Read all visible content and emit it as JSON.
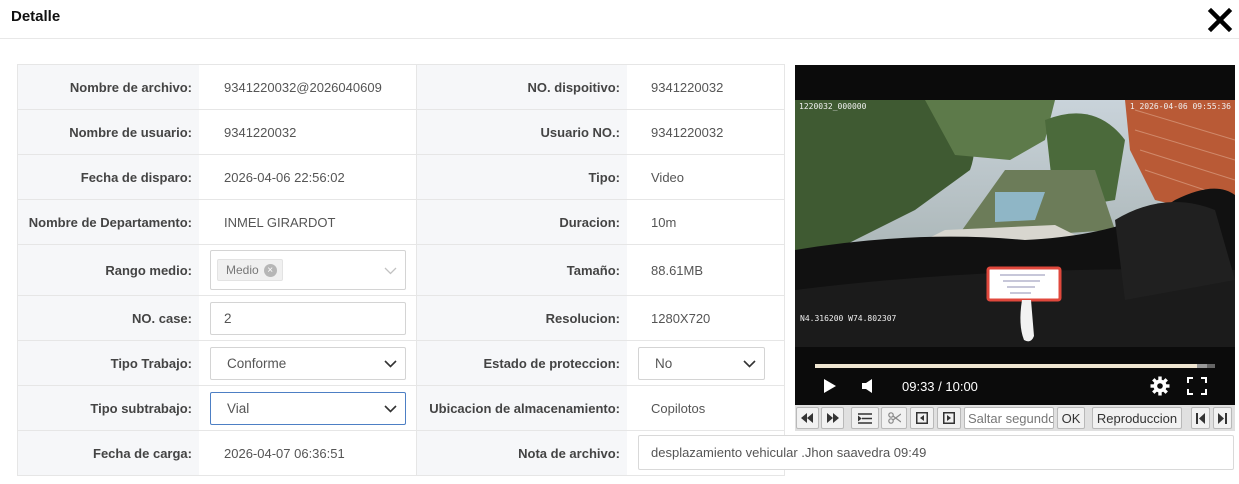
{
  "dialog": {
    "title": "Detalle",
    "close_icon": "close-icon"
  },
  "fields": {
    "nombre_archivo": {
      "label": "Nombre de archivo:",
      "value": "9341220032@2026040609"
    },
    "no_dispositivo": {
      "label": "NO. dispoitivo:",
      "value": "9341220032"
    },
    "nombre_usuario": {
      "label": "Nombre de usuario:",
      "value": "9341220032"
    },
    "usuario_no": {
      "label": "Usuario NO.:",
      "value": "9341220032"
    },
    "fecha_disparo": {
      "label": "Fecha de disparo:",
      "value": "2026-04-06 22:56:02"
    },
    "tipo": {
      "label": "Tipo:",
      "value": "Video"
    },
    "departamento": {
      "label": "Nombre de Departamento:",
      "value": "INMEL GIRARDOT"
    },
    "duracion": {
      "label": "Duracion:",
      "value": "10m"
    },
    "rango_medio": {
      "label": "Rango medio:",
      "tag": "Medio"
    },
    "tamano": {
      "label": "Tamaño:",
      "value": "88.61MB"
    },
    "no_case": {
      "label": "NO. case:",
      "value": "2"
    },
    "resolucion": {
      "label": "Resolucion:",
      "value": "1280X720"
    },
    "tipo_trabajo": {
      "label": "Tipo Trabajo:",
      "value": "Conforme"
    },
    "estado_proteccion": {
      "label": "Estado de proteccion:",
      "value": "No"
    },
    "tipo_subtrabajo": {
      "label": "Tipo subtrabajo:",
      "value": "Vial"
    },
    "ubicacion": {
      "label": "Ubicacion de almacenamiento:",
      "value": "Copilotos"
    },
    "fecha_carga": {
      "label": "Fecha de carga:",
      "value": "2026-04-07 06:36:51"
    },
    "nota_archivo": {
      "label": "Nota de archivo:",
      "value": "desplazamiento vehicular .Jhon saavedra 09:49"
    }
  },
  "video": {
    "osd_top_left": "1220032_000000",
    "osd_top_right": "1 2026-04-06 09:55:36",
    "osd_coords": "N4.316200  W74.802307",
    "current_time": "09:33",
    "duration": "10:00",
    "time_display": "09:33 / 10:00",
    "progress": 0.955,
    "buffered": 0.98
  },
  "toolbar": {
    "skip_placeholder": "Saltar segundos",
    "ok_label": "OK",
    "playback_label": "Reproduccion"
  }
}
